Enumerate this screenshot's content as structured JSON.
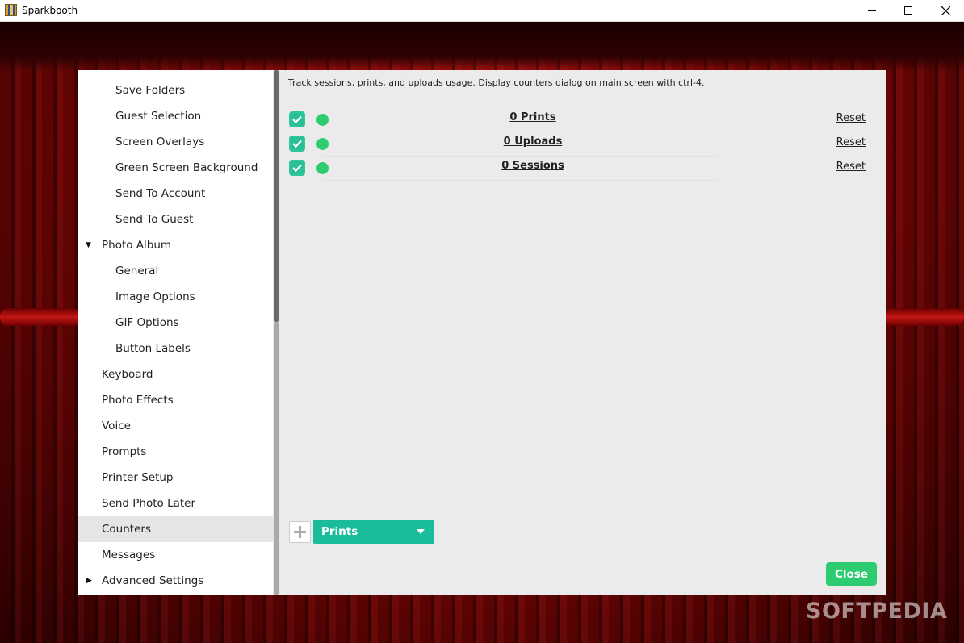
{
  "window": {
    "title": "Sparkbooth",
    "controls": [
      "minimize-icon",
      "maximize-icon",
      "close-icon"
    ]
  },
  "sidebar": {
    "items": [
      {
        "label": "Save Folders",
        "level": 2
      },
      {
        "label": "Guest Selection",
        "level": 2
      },
      {
        "label": "Screen Overlays",
        "level": 2
      },
      {
        "label": "Green Screen Background",
        "level": 2
      },
      {
        "label": "Send To Account",
        "level": 2
      },
      {
        "label": "Send To Guest",
        "level": 2
      },
      {
        "label": "Photo Album",
        "level": 1,
        "expander": "expanded"
      },
      {
        "label": "General",
        "level": 2
      },
      {
        "label": "Image Options",
        "level": 2
      },
      {
        "label": "GIF Options",
        "level": 2
      },
      {
        "label": "Button Labels",
        "level": 2
      },
      {
        "label": "Keyboard",
        "level": 1
      },
      {
        "label": "Photo Effects",
        "level": 1
      },
      {
        "label": "Voice",
        "level": 1
      },
      {
        "label": "Prompts",
        "level": 1
      },
      {
        "label": "Printer Setup",
        "level": 1
      },
      {
        "label": "Send Photo Later",
        "level": 1
      },
      {
        "label": "Counters",
        "level": 1,
        "selected": true
      },
      {
        "label": "Messages",
        "level": 1
      },
      {
        "label": "Advanced Settings",
        "level": 1,
        "expander": "collapsed"
      }
    ]
  },
  "content": {
    "description": "Track sessions, prints, and uploads usage. Display counters dialog on main screen with ctrl-4.",
    "counters": [
      {
        "label": "0 Prints",
        "checked": true,
        "reset_label": "Reset"
      },
      {
        "label": "0 Uploads",
        "checked": true,
        "reset_label": "Reset"
      },
      {
        "label": "0 Sessions",
        "checked": true,
        "reset_label": "Reset"
      }
    ],
    "add_dropdown": {
      "selected": "Prints"
    },
    "close_label": "Close"
  },
  "watermark": "SOFTPEDIA",
  "colors": {
    "accent": "#1abc9c",
    "dot": "#2ecc71",
    "checkbox": "#2abf96",
    "curtain": "#b11010"
  }
}
